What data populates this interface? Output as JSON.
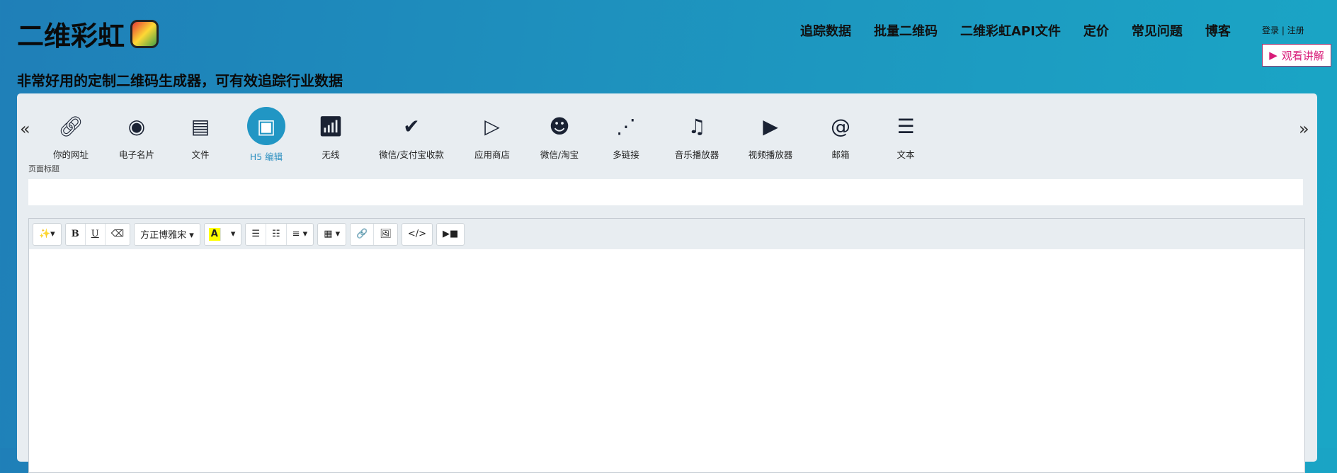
{
  "brand": {
    "name": "二维彩虹",
    "tagline": "非常好用的定制二维码生成器，可有效追踪行业数据"
  },
  "nav": [
    "追踪数据",
    "批量二维码",
    "二维彩虹API文件",
    "定价",
    "常见问题",
    "博客"
  ],
  "auth": {
    "login": "登录",
    "sep": "|",
    "register": "注册"
  },
  "watch_button": {
    "icon": "play-icon",
    "label": "观看讲解",
    "color": "#d81b78"
  },
  "tabs": [
    {
      "label": "你的网址",
      "icon": "link-icon"
    },
    {
      "label": "电子名片",
      "icon": "user-icon"
    },
    {
      "label": "文件",
      "icon": "pdf-icon"
    },
    {
      "label": "H5 编辑",
      "icon": "html-icon",
      "active": true
    },
    {
      "label": "无线",
      "icon": "wifi-icon"
    },
    {
      "label": "微信/支付宝收款",
      "icon": "payment-icon"
    },
    {
      "label": "应用商店",
      "icon": "app-store-icon"
    },
    {
      "label": "微信/淘宝",
      "icon": "wechat-icon"
    },
    {
      "label": "多链接",
      "icon": "multi-link-icon"
    },
    {
      "label": "音乐播放器",
      "icon": "music-icon"
    },
    {
      "label": "视频播放器",
      "icon": "video-icon"
    },
    {
      "label": "邮箱",
      "icon": "at-icon"
    },
    {
      "label": "文本",
      "icon": "text-icon"
    }
  ],
  "arrows": {
    "prev": "«",
    "next": "»"
  },
  "form": {
    "page_title_label": "页面标题",
    "page_title_value": ""
  },
  "toolbar": {
    "magic": "✨▾",
    "bold": "B",
    "underline": "U",
    "eraser": "⌫",
    "font": "方正博雅宋 ▾",
    "color": "A",
    "color_drop": "▾",
    "ul": "☰",
    "ol": "☷",
    "align": "≡ ▾",
    "table": "▦ ▾",
    "link": "🔗",
    "image": "🖼",
    "code": "</>",
    "video": "▶■"
  },
  "accent": "#2196c4"
}
